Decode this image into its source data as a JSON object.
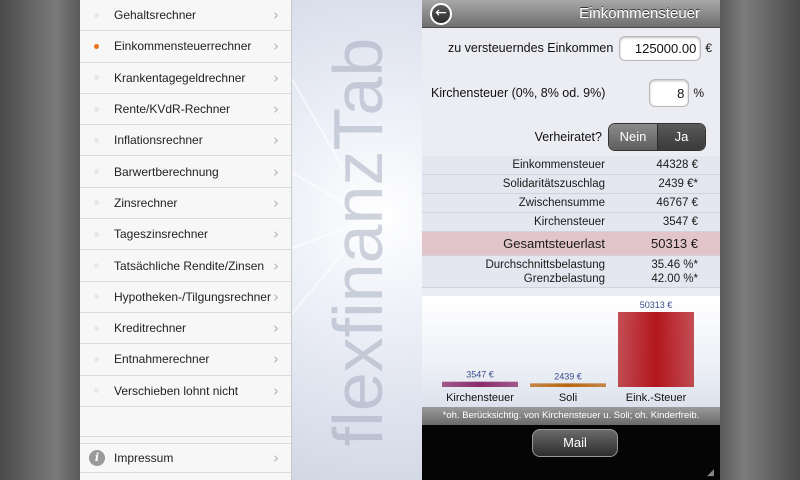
{
  "sidebar": {
    "items": [
      {
        "label": "Gehaltsrechner"
      },
      {
        "label": "Einkommensteuerrechner"
      },
      {
        "label": "Krankentagegeldrechner"
      },
      {
        "label": "Rente/KVdR-Rechner"
      },
      {
        "label": "Inflationsrechner"
      },
      {
        "label": "Barwertberechnung"
      },
      {
        "label": "Zinsrechner"
      },
      {
        "label": "Tageszinsrechner"
      },
      {
        "label": "Tatsächliche Rendite/Zinsen"
      },
      {
        "label": "Hypotheken-/Tilgungsrechner"
      },
      {
        "label": "Kreditrechner"
      },
      {
        "label": "Entnahmerechner"
      },
      {
        "label": "Verschieben lohnt nicht"
      }
    ],
    "impressum": "Impressum",
    "active_color": "#e8731a"
  },
  "brand": {
    "wordmark": "flexfinanzTab"
  },
  "panel": {
    "title": "Einkommensteuer",
    "income_label": "zu versteuerndes Einkommen",
    "income_value": "125000.00",
    "income_unit": "€",
    "church_label": "Kirchensteuer (0%, 8% od. 9%)",
    "church_value": "8",
    "church_unit": "%",
    "married_label": "Verheiratet?",
    "married_no": "Nein",
    "married_yes": "Ja"
  },
  "results": {
    "r1_label": "Einkommensteuer",
    "r1_value": "44328  €",
    "r2_label": "Solidaritätszuschlag",
    "r2_value": "2439 €*",
    "r3_label": "Zwischensumme",
    "r3_value": "46767  €",
    "r4_label": "Kirchensteuer",
    "r4_value": "3547  €",
    "total_label": "Gesamtsteuerlast",
    "total_value": "50313  €",
    "avg_label": "Durchschnittsbelastung",
    "avg_value": "35.46 %*",
    "marg_label": "Grenzbelastung",
    "marg_value": "42.00 %*"
  },
  "chart_data": {
    "type": "bar",
    "categories": [
      "Kirchensteuer",
      "Soli",
      "Eink.-Steuer"
    ],
    "values": [
      3547,
      2439,
      50313
    ],
    "value_labels": [
      "3547 €",
      "2439 €",
      "50313 €"
    ],
    "colors": [
      "#8a2a6a",
      "#b8660f",
      "#b3161d"
    ],
    "ylim": [
      0,
      50313
    ]
  },
  "footnote": "*oh. Berücksichtig. von Kirchensteuer u. Soli; oh. Kinderfreib.",
  "mail_label": "Mail"
}
